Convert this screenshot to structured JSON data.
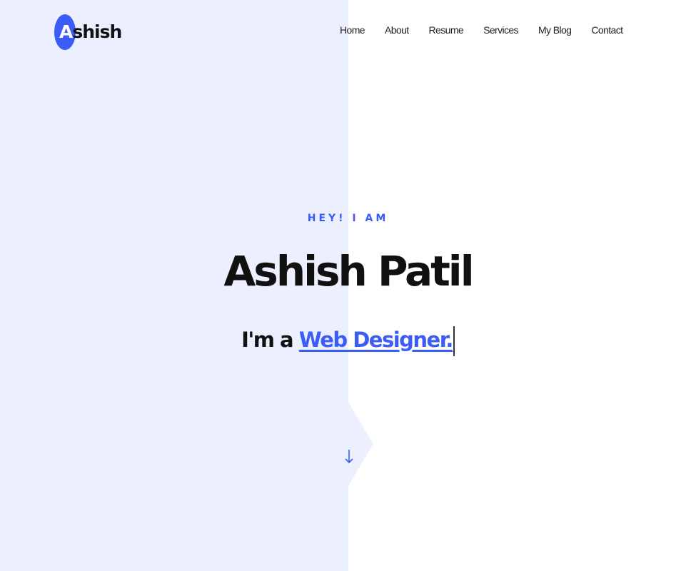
{
  "logo": {
    "first_letter": "A",
    "rest": "shish"
  },
  "nav": {
    "items": [
      {
        "label": "Home"
      },
      {
        "label": "About"
      },
      {
        "label": "Resume"
      },
      {
        "label": "Services"
      },
      {
        "label": "My Blog"
      },
      {
        "label": "Contact"
      }
    ]
  },
  "hero": {
    "eyebrow": "HEY! I AM",
    "name": "Ashish Patil",
    "tagline_prefix": "I'm a",
    "role": "Web Designer."
  },
  "icons": {
    "scroll": "arrow-down-icon"
  },
  "colors": {
    "accent": "#3b5cf6",
    "left_panel": "#eceffe",
    "text": "#111111"
  }
}
